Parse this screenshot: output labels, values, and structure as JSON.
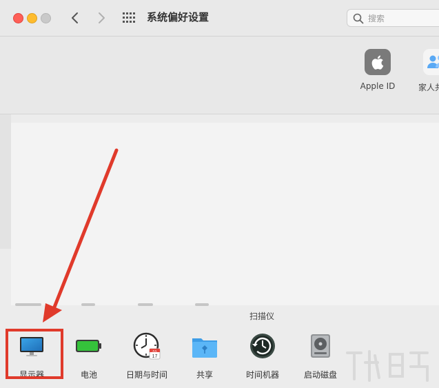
{
  "window": {
    "title": "系统偏好设置",
    "search_placeholder": "搜索"
  },
  "account": {
    "apple_id_label": "Apple ID",
    "family_label": "家人共"
  },
  "scanner_label": "扫描仪",
  "panes": [
    {
      "id": "display",
      "label": "显示器",
      "icon": "display-icon"
    },
    {
      "id": "battery",
      "label": "电池",
      "icon": "battery-icon"
    },
    {
      "id": "datetime",
      "label": "日期与时间",
      "icon": "clock-calendar-icon"
    },
    {
      "id": "sharing",
      "label": "共享",
      "icon": "sharing-folder-icon"
    },
    {
      "id": "timemachine",
      "label": "时间机器",
      "icon": "time-machine-icon"
    },
    {
      "id": "startup",
      "label": "启动磁盘",
      "icon": "startup-disk-icon"
    }
  ],
  "calendar_badge": {
    "month": "JUL",
    "day": "17"
  },
  "colors": {
    "annotation_red": "#e03a2b",
    "close": "#fe5f57",
    "minimize": "#febc2e"
  }
}
